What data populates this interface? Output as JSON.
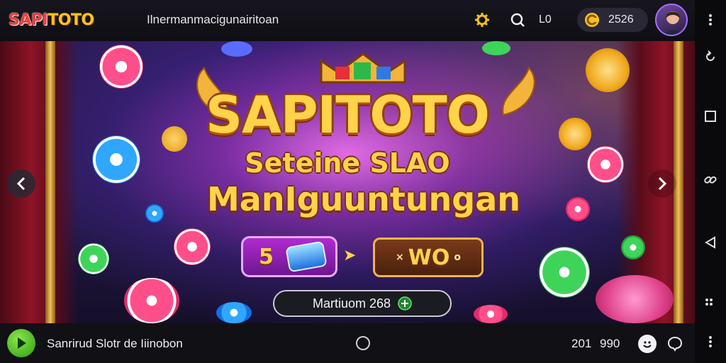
{
  "header": {
    "logo_part1": "SAPI",
    "logo_part2": "TOTO",
    "title": "Ilnermanmacigunairitoan",
    "status_text": "L0",
    "coin_balance": "2526",
    "icons": [
      "gear-icon",
      "search-icon",
      "coin-icon",
      "avatar"
    ]
  },
  "banner": {
    "title": "SAPITOTO",
    "subtitle_line1": "Seteine SLAO",
    "subtitle_line2": "ManIguuntungan",
    "badge_left_value": "5",
    "badge_right_prefix": "×",
    "badge_right_value": "WO",
    "badge_right_suffix": "o",
    "cta_label": "Martiuom 268",
    "prev_arrow": "chevron-left-icon",
    "next_arrow": "chevron-right-icon"
  },
  "footer": {
    "label": "Sanrirud Slotr de Iiinobon",
    "value_a": "201",
    "value_b": "990"
  },
  "system_nav": [
    "more-icon",
    "refresh-icon",
    "square-icon",
    "link-icon",
    "back-icon",
    "apps-icon"
  ],
  "colors": {
    "accent_gold": "#ffd34a",
    "accent_green": "#3cb82a",
    "bar_bg": "#111015",
    "banner_purple": "#b02ad0"
  }
}
